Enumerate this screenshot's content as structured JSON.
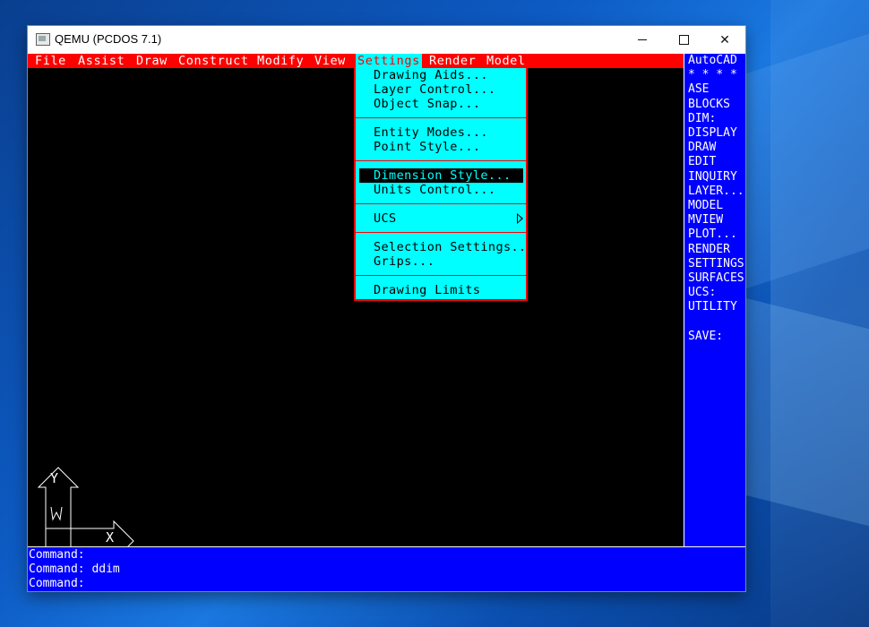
{
  "window": {
    "title": "QEMU (PCDOS 7.1)",
    "controls": {
      "minimize": "",
      "maximize": "",
      "close": "✕"
    }
  },
  "menubar": {
    "items": [
      "File",
      "Assist",
      "Draw",
      "Construct",
      "Modify",
      "View",
      "Settings",
      "Render",
      "Model"
    ],
    "active": "Settings"
  },
  "settings_menu": {
    "groups": [
      [
        "Drawing Aids...",
        "Layer Control...",
        "Object Snap..."
      ],
      [
        "Entity Modes...",
        "Point Style..."
      ],
      [
        "Dimension Style...",
        "Units Control..."
      ],
      [
        "UCS"
      ],
      [
        "Selection Settings...",
        "Grips..."
      ],
      [
        "Drawing Limits"
      ]
    ],
    "selected": "Dimension Style...",
    "submenu_item": "UCS"
  },
  "side_menu": {
    "items": [
      "AutoCAD",
      "* * * *",
      "ASE",
      "BLOCKS",
      "DIM:",
      "DISPLAY",
      "DRAW",
      "EDIT",
      "INQUIRY",
      "LAYER...",
      "MODEL",
      "MVIEW",
      "PLOT...",
      "RENDER",
      "SETTINGS",
      "SURFACES",
      "UCS:",
      "UTILITY",
      "",
      "SAVE:"
    ]
  },
  "ucs_icon": {
    "x_label": "X",
    "y_label": "Y",
    "w_label": "W"
  },
  "command": {
    "lines": [
      "Command:",
      "Command: ddim",
      "Command:"
    ]
  },
  "colors": {
    "menubar": "#fe0000",
    "dropdown": "#00ffff",
    "sidebar": "#0000fe",
    "drawing_area": "#000000"
  }
}
